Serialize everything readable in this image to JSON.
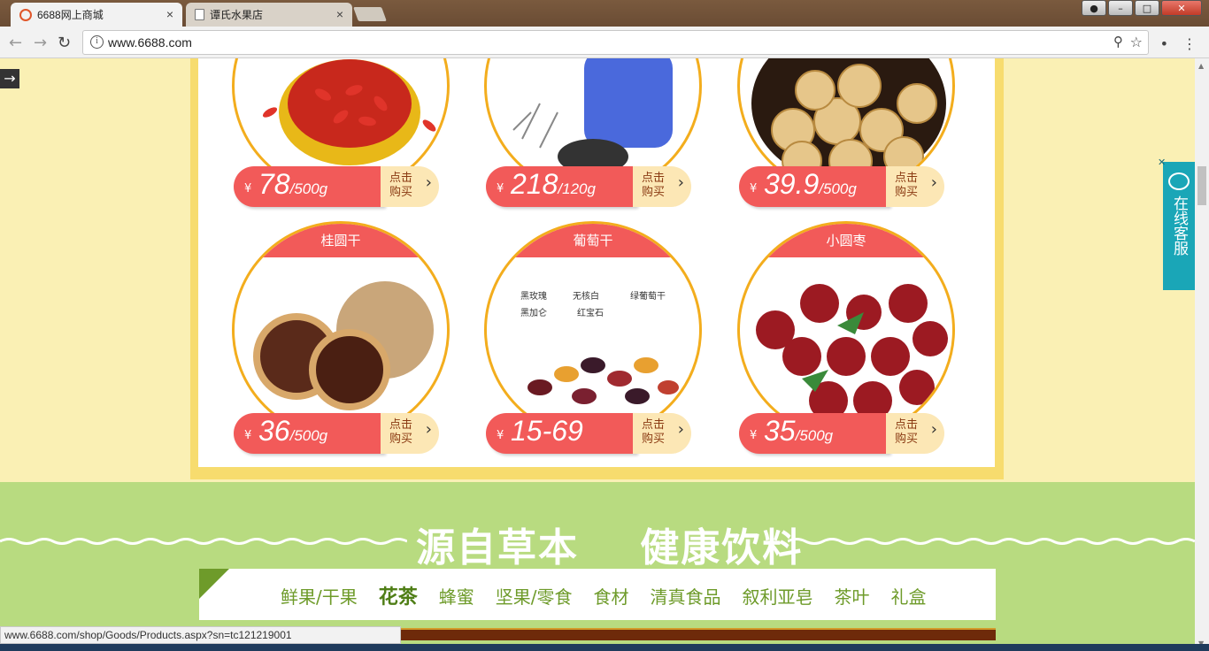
{
  "browser": {
    "tabs": [
      {
        "label": "6688网上商城",
        "active": true
      },
      {
        "label": "谭氏水果店",
        "active": false
      }
    ],
    "url": "www.6688.com",
    "status_url": "www.6688.com/shop/Goods/Products.aspx?sn=tc121219001"
  },
  "products": [
    {
      "name": "",
      "price": "78",
      "unit": "/500g",
      "buy": [
        "点击",
        "购买"
      ],
      "image": "goji-berries"
    },
    {
      "name": "",
      "price": "218",
      "unit": "/120g",
      "buy": [
        "点击",
        "购买"
      ],
      "image": "butterfly-pea-tea"
    },
    {
      "name": "",
      "price": "39.9",
      "unit": "/500g",
      "buy": [
        "点击",
        "购买"
      ],
      "image": "dried-figs"
    },
    {
      "name": "桂圆干",
      "price": "36",
      "unit": "/500g",
      "buy": [
        "点击",
        "购买"
      ],
      "image": "dried-longan"
    },
    {
      "name": "葡萄干",
      "price": "15-69",
      "unit": "",
      "buy": [
        "点击",
        "购买"
      ],
      "image": "raisins",
      "tags": [
        "黑玫瑰",
        "无核白",
        "绿葡萄干",
        "黑加仑",
        "红宝石"
      ]
    },
    {
      "name": "小圆枣",
      "price": "35",
      "unit": "/500g",
      "buy": [
        "点击",
        "购买"
      ],
      "image": "red-dates"
    }
  ],
  "currency": "¥",
  "section": {
    "title_left": "源自草本",
    "title_right": "健康饮料",
    "nav": [
      "鲜果/干果",
      "花茶",
      "蜂蜜",
      "坚果/零食",
      "食材",
      "清真食品",
      "叙利亚皂",
      "茶叶",
      "礼盒"
    ],
    "active_nav": "花茶"
  },
  "chat_widget": {
    "label": "在线客服"
  },
  "colors": {
    "price_red": "#f25a59",
    "ring": "#f3ad1d",
    "green": "#b8db80",
    "teal": "#1aa6b7"
  }
}
